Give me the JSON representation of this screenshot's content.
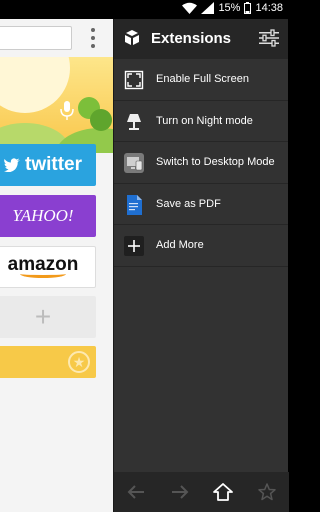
{
  "status_bar": {
    "battery_percent": "15%",
    "time": "14:38",
    "icons": [
      "wifi-icon",
      "signal-icon",
      "battery-icon"
    ]
  },
  "browser": {
    "tiles": {
      "twitter": "twitter",
      "yahoo": "YAHOO!",
      "amazon": "amazon",
      "add": "+"
    }
  },
  "panel": {
    "title": "Extensions",
    "items": [
      {
        "icon": "fullscreen-icon",
        "label": "Enable Full Screen"
      },
      {
        "icon": "lamp-icon",
        "label": "Turn on Night mode"
      },
      {
        "icon": "desktop-icon",
        "label": "Switch to Desktop Mode"
      },
      {
        "icon": "pdf-icon",
        "label": "Save as PDF"
      },
      {
        "icon": "plus-icon",
        "label": "Add More"
      }
    ],
    "footer": [
      "back-arrow-icon",
      "forward-arrow-icon",
      "home-icon",
      "star-icon"
    ]
  },
  "colors": {
    "panel_bg": "#323232",
    "panel_header_bg": "#262626",
    "twitter": "#2aa3df",
    "yahoo": "#8a3fd0",
    "amazon_smile": "#f29a1b"
  }
}
